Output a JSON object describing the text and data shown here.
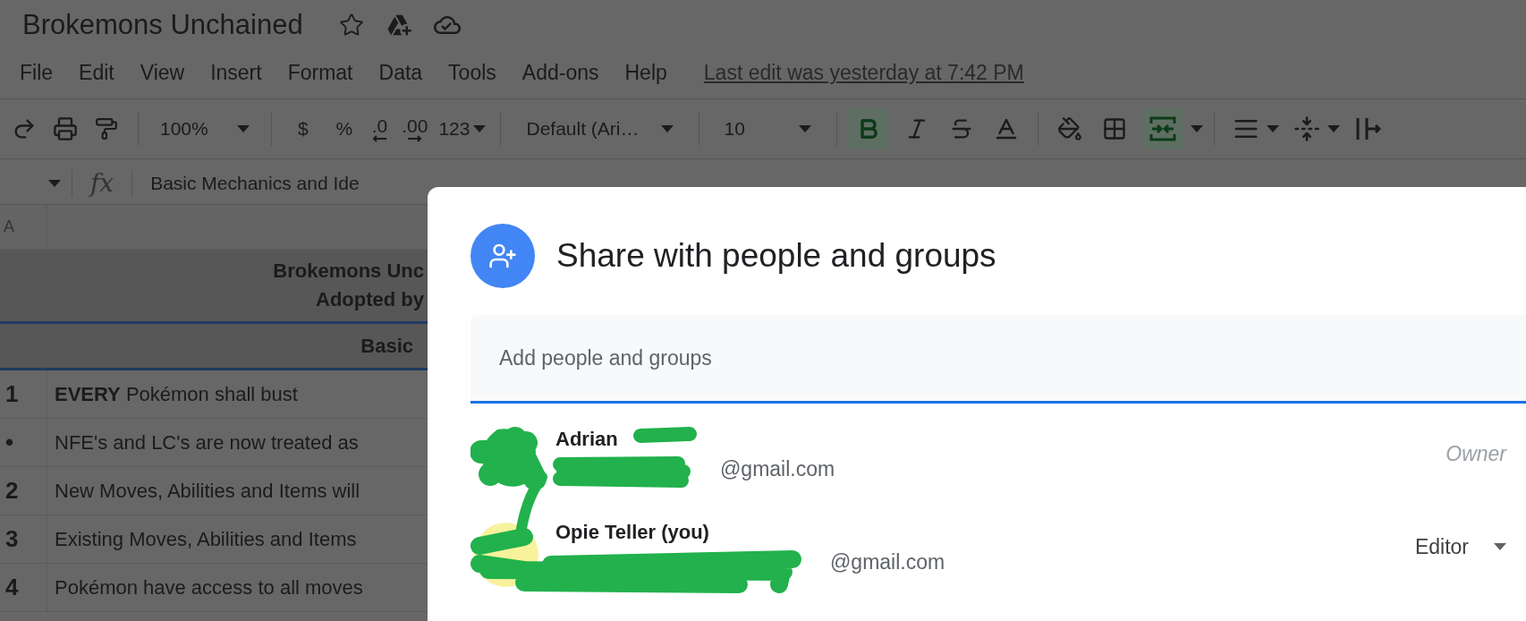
{
  "document": {
    "title": "Brokemons Unchained"
  },
  "menu": [
    {
      "label": "File"
    },
    {
      "label": "Edit"
    },
    {
      "label": "View"
    },
    {
      "label": "Insert"
    },
    {
      "label": "Format"
    },
    {
      "label": "Data"
    },
    {
      "label": "Tools"
    },
    {
      "label": "Add-ons"
    },
    {
      "label": "Help"
    }
  ],
  "last_edit": "Last edit was yesterday at 7:42 PM",
  "toolbar": {
    "zoom": "100%",
    "currency": "$",
    "percent": "%",
    "decrease_decimals": ".0",
    "increase_decimals": ".00",
    "number_format": "123",
    "font": "Default (Ari…",
    "font_size": "10",
    "bold": {
      "selected": true
    },
    "italic": {
      "selected": false
    },
    "strikethrough": {
      "selected": false
    },
    "merge": {
      "selected": true
    }
  },
  "formula_bar": {
    "label": "fx",
    "value": "Basic Mechanics and Ide"
  },
  "sheet": {
    "column_header": "A",
    "title_lines": [
      "Brokemons Unc",
      "Adopted by"
    ],
    "section": "Basic",
    "rows": [
      {
        "number": "1",
        "text": "**EVERY** Pokémon shall bust"
      },
      {
        "number": "•",
        "text": "NFE's and LC's are now treated as"
      },
      {
        "number": "2",
        "text": "New Moves, Abilities and Items will"
      },
      {
        "number": "3",
        "text": "Existing Moves, Abilities and Items"
      },
      {
        "number": "4",
        "text": "Pokémon have access to all moves"
      }
    ]
  },
  "share_dialog": {
    "title": "Share with people and groups",
    "field": {
      "placeholder": "Add people and groups"
    },
    "people": [
      {
        "name": "Adrian",
        "email": "@gmail.com",
        "role": "Owner",
        "editable": false
      },
      {
        "name": "Opie Teller (you)",
        "email": "@gmail.com",
        "role": "Editor",
        "editable": true
      }
    ]
  }
}
